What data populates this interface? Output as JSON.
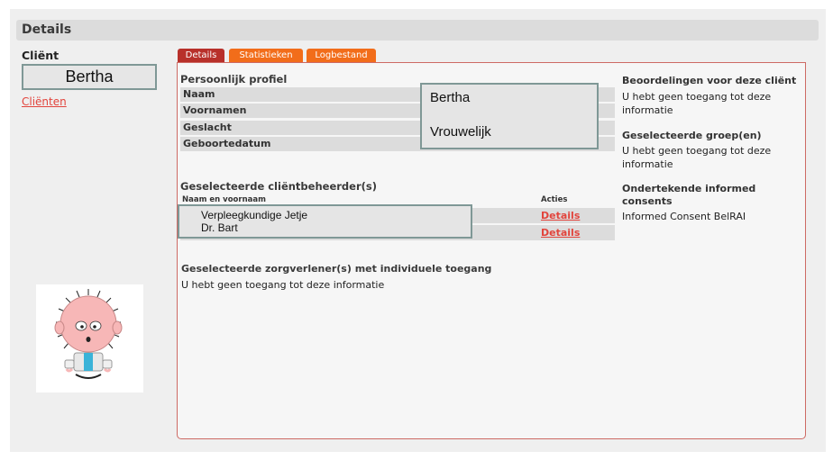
{
  "header": {
    "title": "Details"
  },
  "client": {
    "label": "Cliënt",
    "name": "Bertha",
    "back_link": "Cliënten"
  },
  "tabs": [
    {
      "label": "Details",
      "active": true
    },
    {
      "label": "Statistieken",
      "active": false
    },
    {
      "label": "Logbestand",
      "active": false
    }
  ],
  "profile": {
    "title": "Persoonlijk profiel",
    "fields": [
      {
        "label": "Naam",
        "value": "Bertha"
      },
      {
        "label": "Voornamen",
        "value": ""
      },
      {
        "label": "Geslacht",
        "value": "Vrouwelijk"
      },
      {
        "label": "Geboortedatum",
        "value": ""
      }
    ]
  },
  "managers": {
    "title": "Geselecteerde cliëntbeheerder(s)",
    "col_name": "Naam en voornaam",
    "col_actions": "Acties",
    "rows": [
      {
        "name": "Verpleegkundige Jetje",
        "action": "Details"
      },
      {
        "name": "Dr. Bart",
        "action": "Details"
      }
    ]
  },
  "caregivers": {
    "title": "Geselecteerde zorgverlener(s) met individuele toegang",
    "message": "U hebt geen toegang tot deze informatie"
  },
  "right_panel": {
    "assessments_title": "Beoordelingen voor deze cliënt",
    "assessments_text": "U hebt geen toegang tot deze informatie",
    "groups_title": "Geselecteerde groep(en)",
    "groups_text": "U hebt geen toegang tot deze informatie",
    "consents_title": "Ondertekende informed consents",
    "consents_text": "Informed Consent BelRAI"
  },
  "colors": {
    "tab_active": "#b8302a",
    "tab_inactive": "#f26d1a",
    "link": "#e2443c",
    "highlight_border": "#7f9896"
  },
  "icons": {
    "avatar": "cartoon-avatar-icon"
  }
}
